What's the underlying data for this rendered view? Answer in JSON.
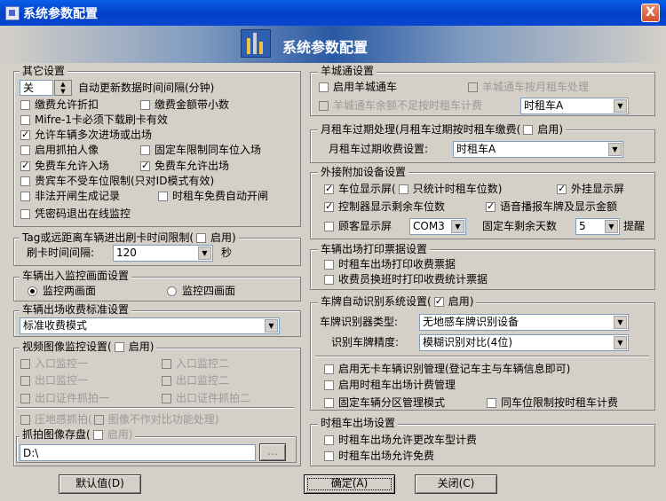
{
  "window": {
    "title": "系统参数配置",
    "close_label": "X"
  },
  "header": {
    "title": "系统参数配置"
  },
  "other": {
    "legend": "其它设置",
    "spin_value": "关",
    "spin_label": "自动更新数据时间间隔(分钟)",
    "opt1": "缴费允许折扣",
    "opt2": "缴费金额带小数",
    "opt3": "Mifre-1卡必须下载刷卡有效",
    "opt4": "允许车辆多次进场或出场",
    "opt5": "启用抓拍人像",
    "opt6": "固定车限制同车位入场",
    "opt7": "免费车允许入场",
    "opt8": "免费车允许出场",
    "opt9": "贵宾车不受车位限制(只对ID模式有效)",
    "opt10": "非法开闸生成记录",
    "opt11": "时租车免费自动开闸",
    "opt12": "凭密码退出在线监控"
  },
  "tag": {
    "legend": "Tag或远距离车辆进出刷卡时间限制(",
    "enable": "启用)",
    "interval_label": "刷卡时间间隔:",
    "interval_value": "120",
    "unit": "秒"
  },
  "monitor": {
    "legend": "车辆出入监控画面设置",
    "two": "监控两画面",
    "four": "监控四画面"
  },
  "fee": {
    "legend": "车辆出场收费标准设置",
    "value": "标准收费模式"
  },
  "video": {
    "legend": "视频图像监控设置(",
    "enable": "启用)",
    "in1": "入口监控一",
    "in2": "入口监控二",
    "out1": "出口监控一",
    "out2": "出口监控二",
    "cert1": "出口证件抓拍一",
    "cert2": "出口证件抓拍二",
    "ground": "压地感抓拍(",
    "nocompare": "图像不作对比功能处理)",
    "store_legend": "抓拍图像存盘(",
    "store_enable": "启用)",
    "path": "D:\\",
    "browse": "..."
  },
  "yangcheng": {
    "legend": "羊城通设置",
    "enable": "启用羊城通车",
    "monthly": "羊城通车按月租车处理",
    "insufficient": "羊城通车余额不足按时租车计费",
    "type": "时租车A"
  },
  "monthly_expire": {
    "legend": "月租车过期处理(月租车过期按时租车缴费(",
    "enable": "启用)",
    "fee_label": "月租车过期收费设置:",
    "fee_value": "时租车A"
  },
  "external": {
    "legend": "外接附加设备设置",
    "space_screen": "车位显示屏(",
    "only_hourly": "只统计时租车位数)",
    "ext_screen": "外挂显示屏",
    "controller": "控制器显示剩余车位数",
    "voice": "语音播报车牌及显示金额",
    "customer": "顾客显示屏",
    "com": "COM3",
    "days_label": "固定车剩余天数",
    "days_value": "5",
    "remind": "提醒"
  },
  "print": {
    "legend": "车辆出场打印票据设置",
    "hourly": "时租车出场打印收费票据",
    "shift": "收费员换班时打印收费统计票据"
  },
  "plate": {
    "legend": "车牌自动识别系统设置(",
    "enable": "启用)",
    "recognizer_label": "车牌识别器类型:",
    "recognizer_value": "无地感车牌识别设备",
    "accuracy_label": "识别车牌精度:",
    "accuracy_value": "模糊识别对比(4位)",
    "no_card": "启用无卡车辆识别管理(登记车主与车辆信息即可)",
    "hourly_mgmt": "启用时租车出场计费管理",
    "zone": "固定车辆分区管理模式",
    "same_space": "同车位限制按时租车计费"
  },
  "hourly_exit": {
    "legend": "时租车出场设置",
    "change_type": "时租车出场允许更改车型计费",
    "free": "时租车出场允许免费"
  },
  "buttons": {
    "default": "默认值(D)",
    "ok": "确定(A)",
    "close": "关闭(C)"
  }
}
